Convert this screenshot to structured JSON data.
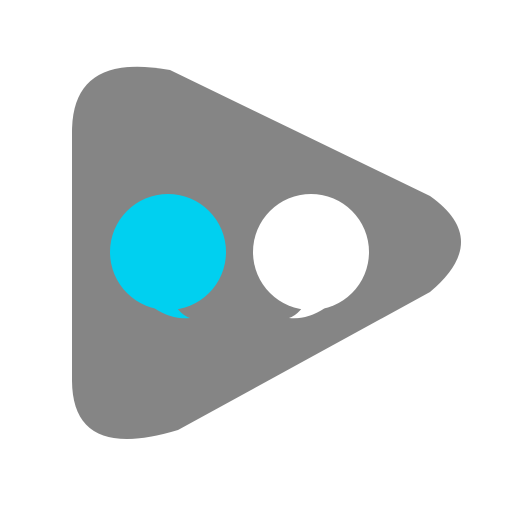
{
  "icon": {
    "name": "play-chat-app-icon",
    "shape": "rounded-play-triangle",
    "glyphs": [
      "speech-bubble-icon",
      "speech-bubble-icon"
    ]
  },
  "colors": {
    "background": "#ffffff",
    "triangle": "#858585",
    "bubble_left": "#00d0f0",
    "bubble_right": "#ffffff"
  }
}
